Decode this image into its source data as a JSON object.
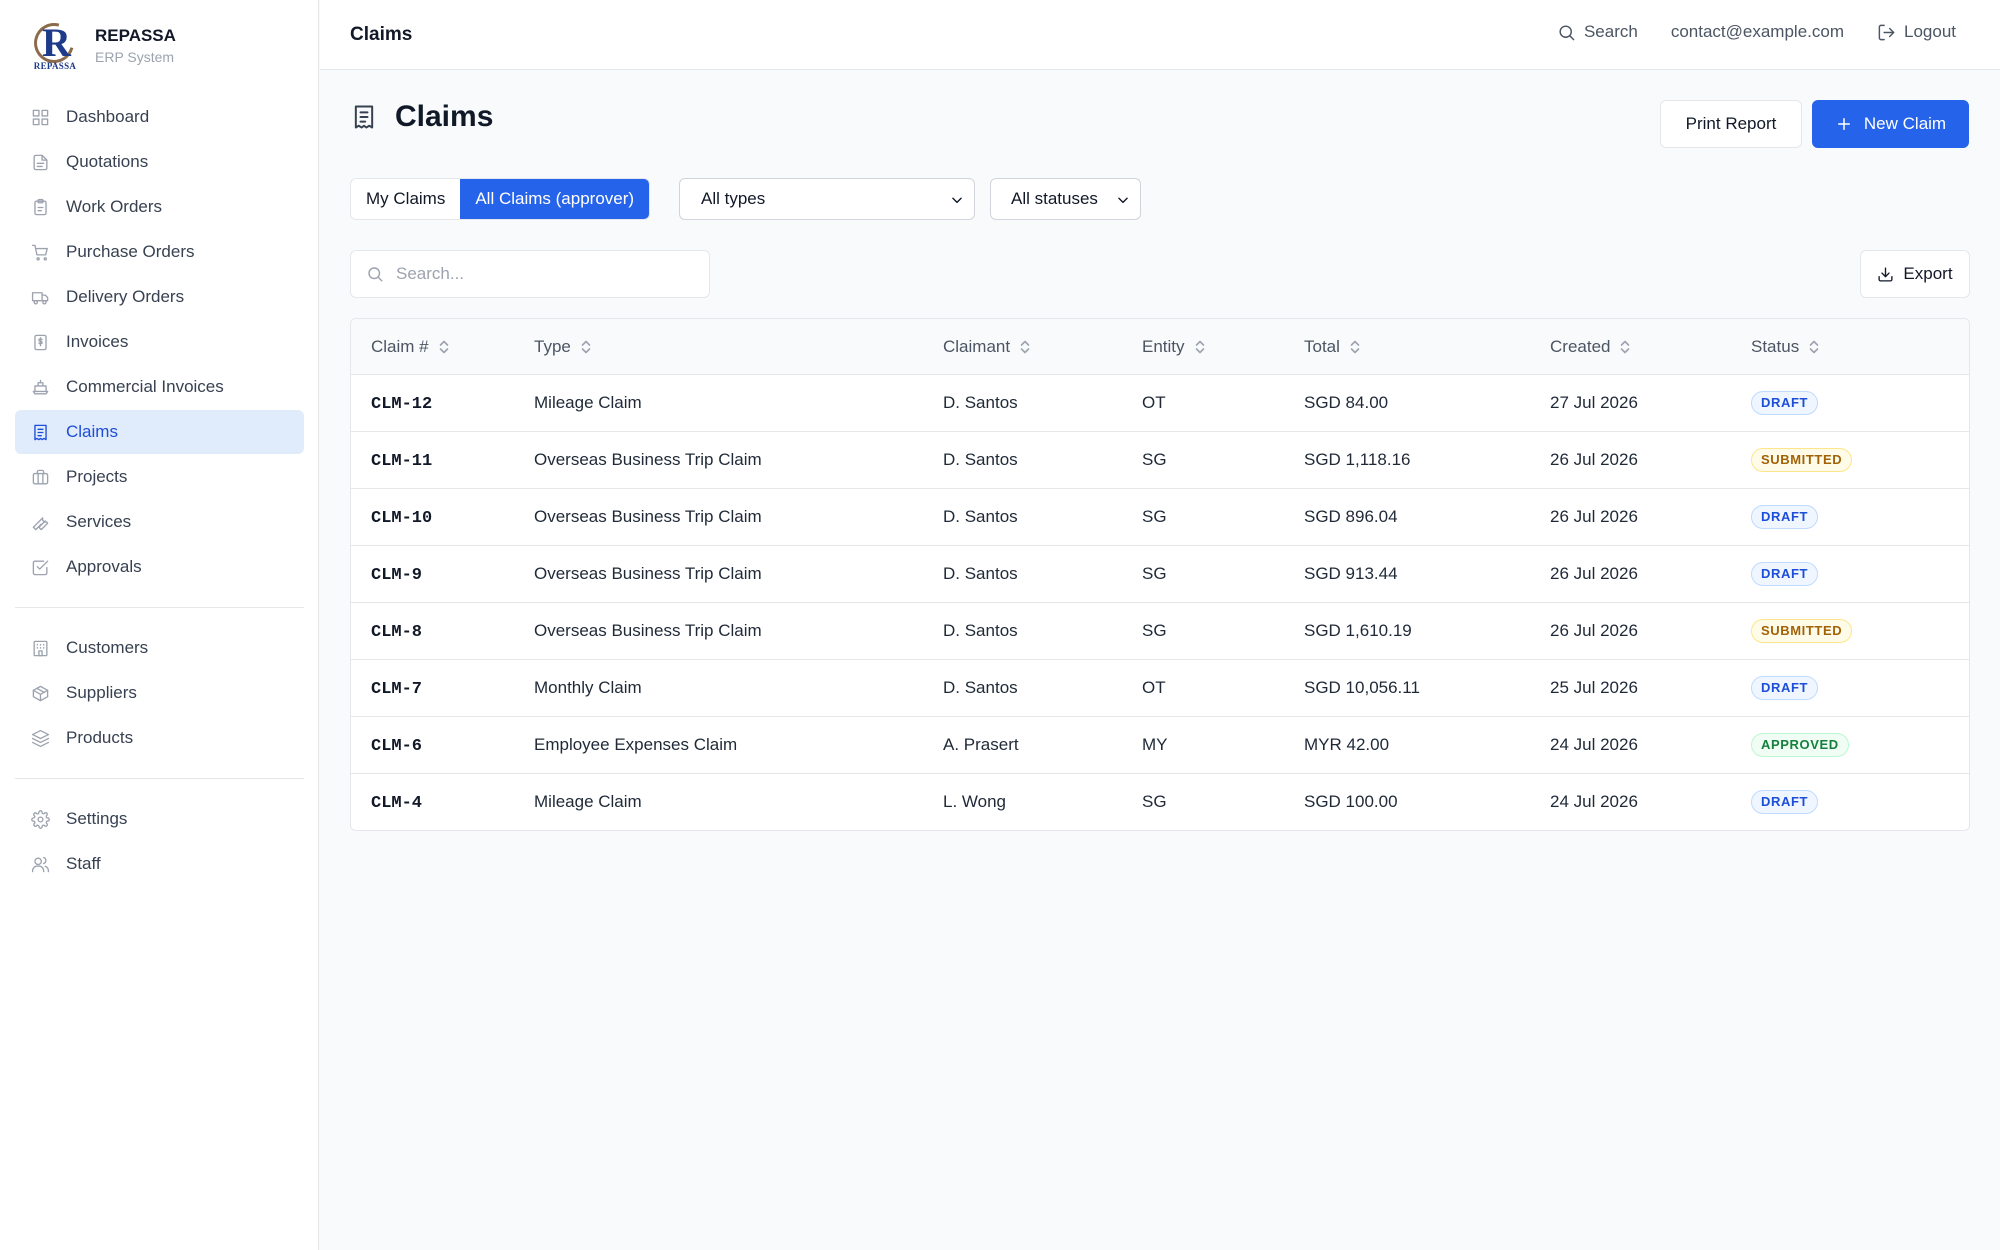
{
  "brand": {
    "name": "REPASSA",
    "subtitle": "ERP System",
    "logo_letter": "R",
    "logo_word": "REPASSA"
  },
  "sidebar": {
    "groups": [
      [
        {
          "label": "Dashboard",
          "icon": "dashboard-icon"
        },
        {
          "label": "Quotations",
          "icon": "document-icon"
        },
        {
          "label": "Work Orders",
          "icon": "clipboard-icon"
        },
        {
          "label": "Purchase Orders",
          "icon": "cart-icon"
        },
        {
          "label": "Delivery Orders",
          "icon": "truck-icon"
        },
        {
          "label": "Invoices",
          "icon": "invoice-icon"
        },
        {
          "label": "Commercial Invoices",
          "icon": "ship-icon"
        },
        {
          "label": "Claims",
          "icon": "receipt-icon",
          "active": true
        },
        {
          "label": "Projects",
          "icon": "briefcase-icon"
        },
        {
          "label": "Services",
          "icon": "wrench-icon"
        },
        {
          "label": "Approvals",
          "icon": "check-square-icon"
        }
      ],
      [
        {
          "label": "Customers",
          "icon": "building-icon"
        },
        {
          "label": "Suppliers",
          "icon": "package-icon"
        },
        {
          "label": "Products",
          "icon": "layers-icon"
        }
      ],
      [
        {
          "label": "Settings",
          "icon": "gear-icon"
        },
        {
          "label": "Staff",
          "icon": "users-icon"
        }
      ]
    ]
  },
  "topbar": {
    "title": "Claims",
    "search_label": "Search",
    "email": "contact@example.com",
    "logout_label": "Logout"
  },
  "page": {
    "title": "Claims",
    "print_label": "Print Report",
    "new_label": "New Claim",
    "tabs": {
      "mine": "My Claims",
      "all": "All Claims (approver)"
    },
    "type_filter": "All types",
    "status_filter": "All statuses",
    "search_placeholder": "Search...",
    "export_label": "Export"
  },
  "table": {
    "headers": [
      "Claim #",
      "Type",
      "Claimant",
      "Entity",
      "Total",
      "Created",
      "Status"
    ],
    "rows": [
      {
        "id": "CLM-12",
        "type": "Mileage Claim",
        "claimant": "D. Santos",
        "entity": "OT",
        "total": "SGD 84.00",
        "created": "27 Jul 2026",
        "status": "DRAFT"
      },
      {
        "id": "CLM-11",
        "type": "Overseas Business Trip Claim",
        "claimant": "D. Santos",
        "entity": "SG",
        "total": "SGD 1,118.16",
        "created": "26 Jul 2026",
        "status": "SUBMITTED"
      },
      {
        "id": "CLM-10",
        "type": "Overseas Business Trip Claim",
        "claimant": "D. Santos",
        "entity": "SG",
        "total": "SGD 896.04",
        "created": "26 Jul 2026",
        "status": "DRAFT"
      },
      {
        "id": "CLM-9",
        "type": "Overseas Business Trip Claim",
        "claimant": "D. Santos",
        "entity": "SG",
        "total": "SGD 913.44",
        "created": "26 Jul 2026",
        "status": "DRAFT"
      },
      {
        "id": "CLM-8",
        "type": "Overseas Business Trip Claim",
        "claimant": "D. Santos",
        "entity": "SG",
        "total": "SGD 1,610.19",
        "created": "26 Jul 2026",
        "status": "SUBMITTED"
      },
      {
        "id": "CLM-7",
        "type": "Monthly Claim",
        "claimant": "D. Santos",
        "entity": "OT",
        "total": "SGD 10,056.11",
        "created": "25 Jul 2026",
        "status": "DRAFT"
      },
      {
        "id": "CLM-6",
        "type": "Employee Expenses Claim",
        "claimant": "A. Prasert",
        "entity": "MY",
        "total": "MYR 42.00",
        "created": "24 Jul 2026",
        "status": "APPROVED"
      },
      {
        "id": "CLM-4",
        "type": "Mileage Claim",
        "claimant": "L. Wong",
        "entity": "SG",
        "total": "SGD 100.00",
        "created": "24 Jul 2026",
        "status": "DRAFT"
      }
    ]
  },
  "colors": {
    "accent": "#2563eb",
    "active_bg": "#e0ebfb",
    "draft": "#1d4ed8",
    "submitted": "#a16207",
    "approved": "#15803d"
  }
}
